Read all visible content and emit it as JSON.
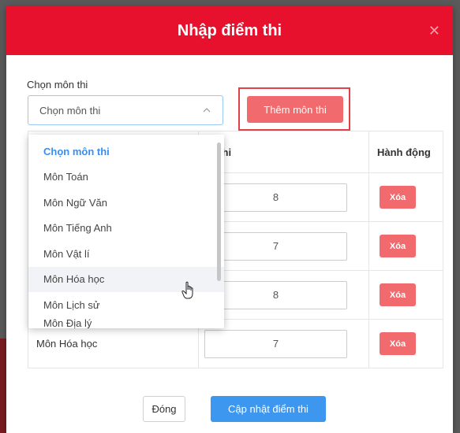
{
  "modal": {
    "title": "Nhập điểm thi",
    "close_icon": "close-icon"
  },
  "subject_picker": {
    "label": "Chọn môn thi",
    "selected_value": "Chọn môn thi",
    "add_button_label": "Thêm môn thi",
    "caret_icon": "chevron-down-icon"
  },
  "table": {
    "headers": [
      "",
      "m thi",
      "Hành động"
    ],
    "rows": [
      {
        "subject": "",
        "score": "8",
        "action": "Xóa"
      },
      {
        "subject": "",
        "score": "7",
        "action": "Xóa"
      },
      {
        "subject": "",
        "score": "8",
        "action": "Xóa"
      },
      {
        "subject": "Môn Hóa học",
        "score": "7",
        "action": "Xóa"
      }
    ]
  },
  "dropdown": {
    "options": [
      "Chọn môn thi",
      "Môn Toán",
      "Môn Ngữ Văn",
      "Môn Tiếng Anh",
      "Môn Vật lí",
      "Môn Hóa học",
      "Môn Lịch sử",
      "Môn Địa lý"
    ],
    "hovered": "Môn Hóa học"
  },
  "footer": {
    "close_label": "Đóng",
    "update_label": "Cập nhật điểm thi"
  },
  "colors": {
    "header_red": "#e8112d",
    "danger_button": "#f16a6d",
    "primary_button": "#3d97ee",
    "selected_option": "#3a8ef0"
  }
}
